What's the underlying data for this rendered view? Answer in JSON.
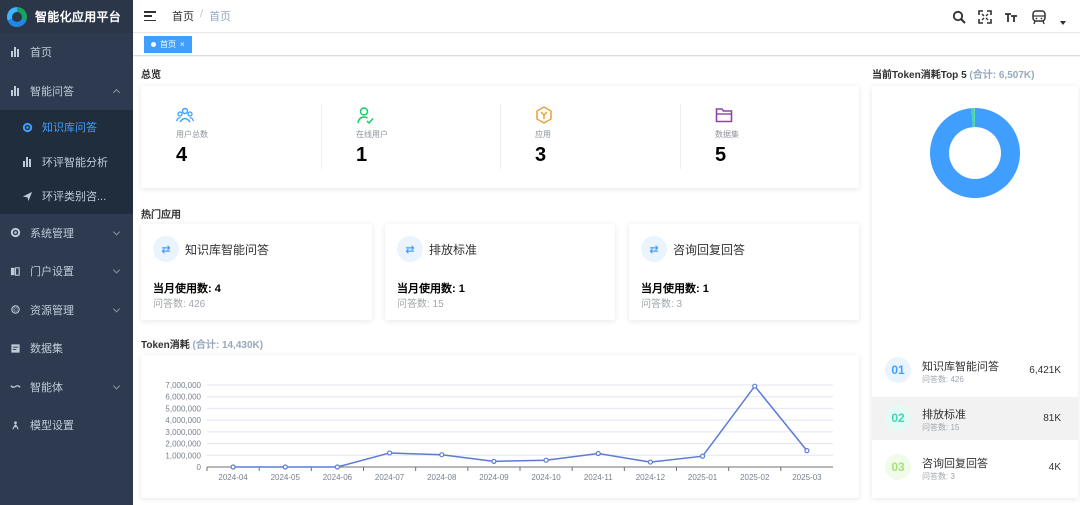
{
  "app": {
    "title": "智能化应用平台"
  },
  "sidebar": {
    "items": [
      {
        "label": "首页",
        "icon": "bar-chart-icon"
      },
      {
        "label": "智能问答",
        "icon": "bar-chart-icon",
        "expanded": true,
        "children": [
          {
            "label": "知识库问答",
            "icon": "gear-icon",
            "active": true
          },
          {
            "label": "环评智能分析",
            "icon": "bar-chart-icon"
          },
          {
            "label": "环评类别咨...",
            "icon": "send-icon"
          }
        ]
      },
      {
        "label": "系统管理",
        "icon": "gear-icon"
      },
      {
        "label": "门户设置",
        "icon": "book-icon"
      },
      {
        "label": "资源管理",
        "icon": "resource-icon"
      },
      {
        "label": "数据集",
        "icon": "dataset-icon"
      },
      {
        "label": "智能体",
        "icon": "agent-icon"
      },
      {
        "label": "模型设置",
        "icon": "model-icon"
      }
    ]
  },
  "header": {
    "breadcrumb": [
      "首页",
      "首页"
    ]
  },
  "tags": [
    {
      "label": "首页",
      "close": "×"
    }
  ],
  "overview": {
    "title": "总览",
    "stats": [
      {
        "label": "用户总数",
        "value": "4",
        "icon": "users-icon",
        "color": "#409eff"
      },
      {
        "label": "在线用户",
        "value": "1",
        "icon": "online-user-icon",
        "color": "#13ce66"
      },
      {
        "label": "应用",
        "value": "3",
        "icon": "app-cube-icon",
        "color": "#e6a23c"
      },
      {
        "label": "数据集",
        "value": "5",
        "icon": "folder-icon",
        "color": "#8e44ad"
      }
    ]
  },
  "hot_apps": {
    "title": "热门应用",
    "items": [
      {
        "name": "知识库智能问答",
        "usage": "当月使用数: 4",
        "questions": "问答数: 426"
      },
      {
        "name": "排放标准",
        "usage": "当月使用数: 1",
        "questions": "问答数: 15"
      },
      {
        "name": "咨询回复回答",
        "usage": "当月使用数: 1",
        "questions": "问答数: 3"
      }
    ]
  },
  "token_chart": {
    "title": "Token消耗",
    "total": "(合计: 14,430K)"
  },
  "chart_data": {
    "type": "line",
    "x": [
      "2024-04",
      "2024-05",
      "2024-06",
      "2024-07",
      "2024-08",
      "2024-09",
      "2024-10",
      "2024-11",
      "2024-12",
      "2025-01",
      "2025-02",
      "2025-03"
    ],
    "series": [
      {
        "values": [
          0,
          0,
          0,
          1200000,
          1050000,
          480000,
          580000,
          1150000,
          420000,
          920000,
          6900000,
          1400000
        ],
        "color": "#5b7bd5"
      }
    ],
    "yticks": [
      "0",
      "1,000,000",
      "2,000,000",
      "3,000,000",
      "4,000,000",
      "5,000,000",
      "6,000,000",
      "7,000,000"
    ],
    "ylim": [
      0,
      7000000
    ],
    "grid": true
  },
  "top5": {
    "title": "当前Token消耗Top 5",
    "total": "(合计: 6,507K)",
    "donut": [
      {
        "name": "知识库智能问答",
        "value": 6421,
        "color": "#409eff"
      },
      {
        "name": "排放标准",
        "value": 81,
        "color": "#3fd6b0"
      },
      {
        "name": "咨询回复回答",
        "value": 4,
        "color": "#a5e07a"
      }
    ],
    "ranks": [
      {
        "num": "01",
        "name": "知识库智能问答",
        "sub": "问答数: 426",
        "value": "6,421K",
        "color": "#409eff",
        "bg": "#eaf4ff"
      },
      {
        "num": "02",
        "name": "排放标准",
        "sub": "问答数: 15",
        "value": "81K",
        "color": "#3fd6b0",
        "bg": "#e4faf4"
      },
      {
        "num": "03",
        "name": "咨询回复回答",
        "sub": "问答数: 3",
        "value": "4K",
        "color": "#a5e07a",
        "bg": "#f1fbe9"
      }
    ]
  }
}
